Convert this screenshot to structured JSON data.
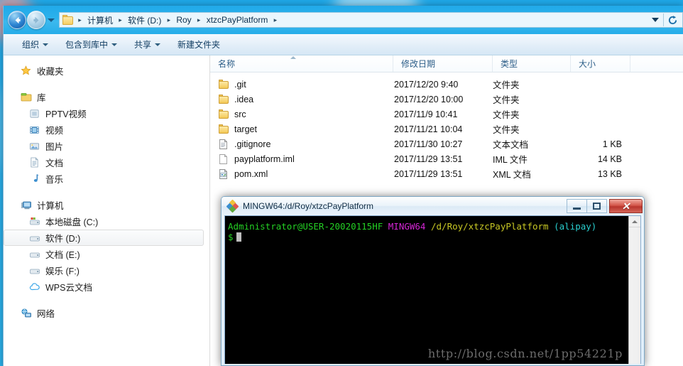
{
  "explorer": {
    "nav": {
      "back_label": "后退",
      "forward_label": "前进",
      "history_label": "最近浏览的位置"
    },
    "address": {
      "crumbs": [
        "计算机",
        "软件 (D:)",
        "Roy",
        "xtzcPayPlatform"
      ],
      "separator": "▸",
      "dropdown_label": "以前的位置",
      "refresh_label": "刷新"
    },
    "toolbar": [
      {
        "label": "组织",
        "caret": true
      },
      {
        "label": "包含到库中",
        "caret": true
      },
      {
        "label": "共享",
        "caret": true
      },
      {
        "label": "新建文件夹",
        "caret": false
      }
    ],
    "sidebar": {
      "groups": [
        {
          "header": {
            "label": "收藏夹",
            "icon": "star-icon"
          },
          "items": []
        },
        {
          "header": {
            "label": "库",
            "icon": "library-icon"
          },
          "items": [
            {
              "label": "PPTV视频",
              "icon": "pptv-icon"
            },
            {
              "label": "视频",
              "icon": "video-icon"
            },
            {
              "label": "图片",
              "icon": "picture-icon"
            },
            {
              "label": "文档",
              "icon": "document-icon"
            },
            {
              "label": "音乐",
              "icon": "music-icon"
            }
          ]
        },
        {
          "header": {
            "label": "计算机",
            "icon": "computer-icon"
          },
          "items": [
            {
              "label": "本地磁盘 (C:)",
              "icon": "system-drive-icon",
              "selected": false
            },
            {
              "label": "软件 (D:)",
              "icon": "drive-icon",
              "selected": true
            },
            {
              "label": "文档 (E:)",
              "icon": "drive-icon",
              "selected": false
            },
            {
              "label": "娱乐 (F:)",
              "icon": "drive-icon",
              "selected": false
            },
            {
              "label": "WPS云文档",
              "icon": "cloud-icon",
              "selected": false
            }
          ]
        },
        {
          "header": {
            "label": "网络",
            "icon": "network-icon"
          },
          "items": []
        }
      ]
    },
    "filelist": {
      "columns": [
        {
          "key": "name",
          "label": "名称",
          "sorted": "asc"
        },
        {
          "key": "date",
          "label": "修改日期",
          "sorted": ""
        },
        {
          "key": "type",
          "label": "类型",
          "sorted": ""
        },
        {
          "key": "size",
          "label": "大小",
          "sorted": ""
        }
      ],
      "rows": [
        {
          "name": ".git",
          "date": "2017/12/20 9:40",
          "type": "文件夹",
          "size": "",
          "icon": "folder-icon"
        },
        {
          "name": ".idea",
          "date": "2017/12/20 10:00",
          "type": "文件夹",
          "size": "",
          "icon": "folder-icon"
        },
        {
          "name": "src",
          "date": "2017/11/9 10:41",
          "type": "文件夹",
          "size": "",
          "icon": "folder-icon"
        },
        {
          "name": "target",
          "date": "2017/11/21 10:04",
          "type": "文件夹",
          "size": "",
          "icon": "folder-icon"
        },
        {
          "name": ".gitignore",
          "date": "2017/11/30 10:27",
          "type": "文本文档",
          "size": "1 KB",
          "icon": "text-file-icon"
        },
        {
          "name": "payplatform.iml",
          "date": "2017/11/29 13:51",
          "type": "IML 文件",
          "size": "14 KB",
          "icon": "blank-file-icon"
        },
        {
          "name": "pom.xml",
          "date": "2017/11/29 13:51",
          "type": "XML 文档",
          "size": "13 KB",
          "icon": "xml-file-icon"
        }
      ]
    }
  },
  "terminal": {
    "title": "MINGW64:/d/Roy/xtzcPayPlatform",
    "icon": "mingw-icon",
    "controls": {
      "minimize_label": "最小化",
      "maximize_label": "最大化",
      "close_label": "关闭"
    },
    "prompt": {
      "user_host": "Administrator@USER-20020115HF",
      "shell": "MINGW64",
      "path": "/d/Roy/xtzcPayPlatform",
      "branch": "(alipay)",
      "dollar": "$",
      "input": ""
    },
    "watermark": "http://blog.csdn.net/1pp54221p",
    "colors": {
      "user_host": "#24d024",
      "shell": "#d426d4",
      "path": "#c8c824",
      "branch": "#29cfcf",
      "background": "#000000"
    }
  }
}
